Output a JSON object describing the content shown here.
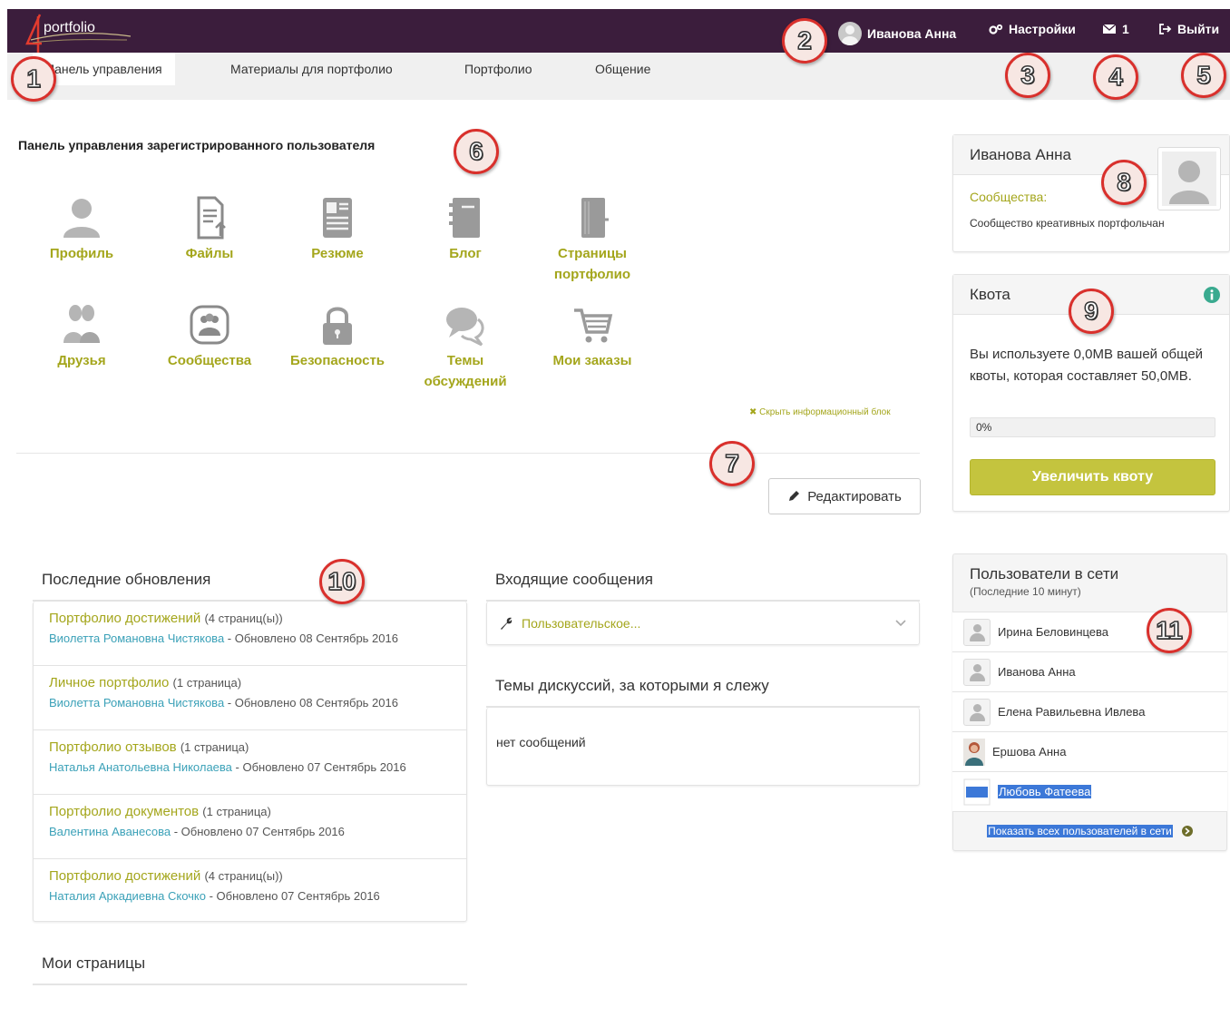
{
  "header": {
    "logo_text": "portfolio",
    "user_name": "Иванова Анна",
    "settings_label": "Настройки",
    "messages_count": "1",
    "logout_label": "Выйти"
  },
  "nav": {
    "tabs": [
      {
        "label": "Панель управления",
        "active": true
      },
      {
        "label": "Материалы для портфолио"
      },
      {
        "label": "Портфолио"
      },
      {
        "label": "Общение"
      }
    ]
  },
  "annotations": [
    "1",
    "2",
    "3",
    "4",
    "5",
    "6",
    "7",
    "8",
    "9",
    "10",
    "11"
  ],
  "dashboard": {
    "title": "Панель управления зарегистрированного пользователя",
    "items": [
      {
        "label": "Профиль",
        "icon": "user-icon"
      },
      {
        "label": "Файлы",
        "icon": "file-upload-icon"
      },
      {
        "label": "Резюме",
        "icon": "resume-icon"
      },
      {
        "label": "Блог",
        "icon": "blog-icon"
      },
      {
        "label": "Страницы портфолио",
        "icon": "notebook-icon"
      },
      {
        "label": "Друзья",
        "icon": "friends-icon"
      },
      {
        "label": "Сообщества",
        "icon": "communities-icon"
      },
      {
        "label": "Безопасность",
        "icon": "lock-icon"
      },
      {
        "label": "Темы обсуждений",
        "icon": "chat-bubbles-icon"
      },
      {
        "label": "Мои заказы",
        "icon": "cart-icon"
      }
    ],
    "hide_link": "✖ Скрыть информационный блок",
    "edit_button": "Редактировать"
  },
  "updates": {
    "title": "Последние обновления",
    "items": [
      {
        "title": "Портфолио достижений",
        "count": "(4 страниц(ы))",
        "author": "Виолетта Романовна Чистякова",
        "updated": " - Обновлено 08 Сентябрь 2016"
      },
      {
        "title": "Личное портфолио",
        "count": "(1 страница)",
        "author": "Виолетта Романовна Чистякова",
        "updated": " - Обновлено 08 Сентябрь 2016"
      },
      {
        "title": "Портфолио отзывов",
        "count": "(1 страница)",
        "author": "Наталья Анатольевна Николаева",
        "updated": " - Обновлено 07 Сентябрь 2016"
      },
      {
        "title": "Портфолио документов",
        "count": "(1 страница)",
        "author": "Валентина Аванесова",
        "updated": " - Обновлено 07 Сентябрь 2016"
      },
      {
        "title": "Портфолио достижений",
        "count": "(4 страниц(ы))",
        "author": "Наталия Аркадиевна Скочко",
        "updated": " - Обновлено 07 Сентябрь 2016"
      }
    ]
  },
  "my_pages": {
    "title": "Мои страницы"
  },
  "inbox": {
    "title": "Входящие сообщения",
    "item": "Пользовательское..."
  },
  "discussions": {
    "title": "Темы дискуссий, за которыми я слежу",
    "empty": "нет сообщений"
  },
  "profile_card": {
    "name": "Иванова Анна",
    "communities_label": "Сообщества:",
    "community": "Сообщество креативных портфольчан"
  },
  "quota": {
    "title": "Квота",
    "text": "Вы используете 0,0MB вашей общей квоты, которая составляет 50,0MB.",
    "progress_label": "0%",
    "progress_value": 0,
    "button": "Увеличить квоту"
  },
  "online": {
    "title": "Пользователи в сети",
    "subtitle": "(Последние 10 минут)",
    "users": [
      {
        "name": "Ирина Беловинцева"
      },
      {
        "name": "Иванова Анна"
      },
      {
        "name": "Елена Равильевна Ивлева"
      },
      {
        "name": "Ершова Анна"
      },
      {
        "name": "Любовь Фатеева"
      }
    ],
    "show_all": "Показать всех пользователей в сети"
  },
  "colors": {
    "topbar": "#3b1d3c",
    "accent": "#a4a61c",
    "link": "#3ba1b8",
    "button": "#c4c43e",
    "annotation": "#d9302c"
  }
}
